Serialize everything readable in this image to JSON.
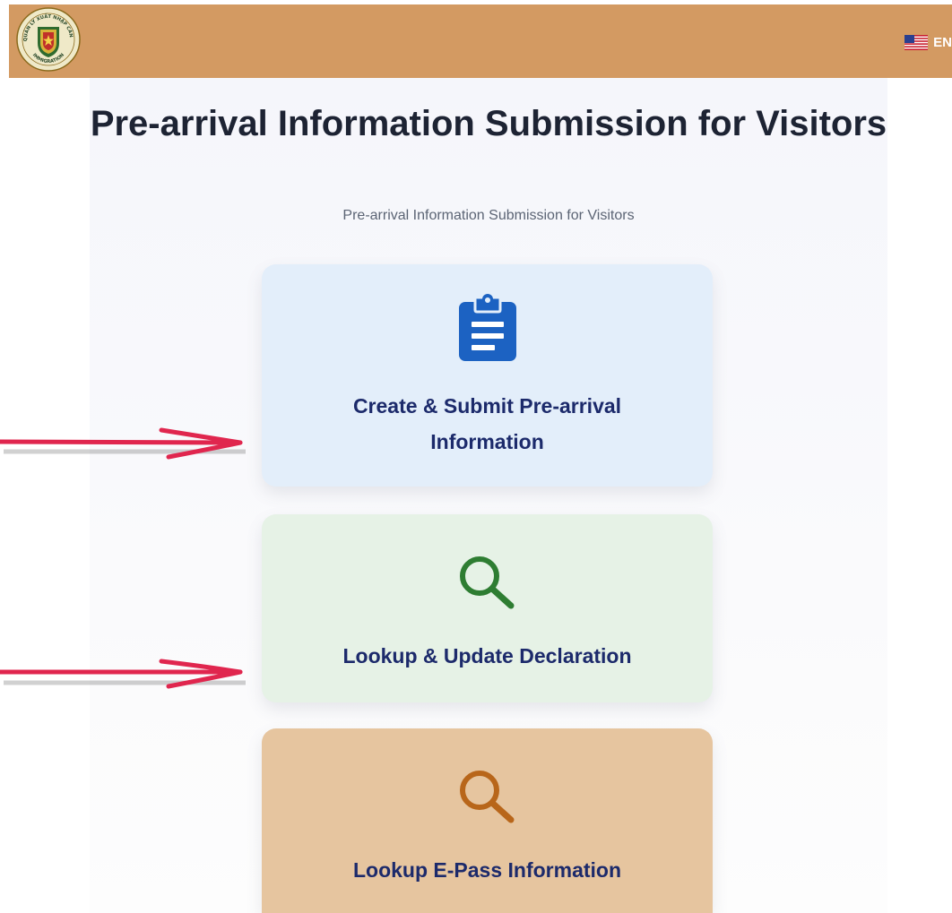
{
  "header": {
    "logo_text_top": "QUẢN LÝ XUẤT NHẬP CẢNH",
    "logo_text_bottom": "IMMIGRATION",
    "language_label": "EN",
    "bar_color": "#d39a62"
  },
  "page": {
    "title": "Pre-arrival Information Submission for Visitors",
    "subtitle": "Pre-arrival Information Submission for Visitors"
  },
  "cards": [
    {
      "label": "Create & Submit Pre-arrival Information",
      "icon": "clipboard-icon",
      "color": "#e3eefa",
      "icon_color": "#1c62c2"
    },
    {
      "label": "Lookup & Update Declaration",
      "icon": "search-icon",
      "color": "#e6f2e6",
      "icon_color": "#2e7d32"
    },
    {
      "label": "Lookup E-Pass Information",
      "icon": "search-icon",
      "color": "#e6c59f",
      "icon_color": "#b8661a"
    }
  ],
  "annotations": {
    "arrow_color": "#e0264e"
  }
}
